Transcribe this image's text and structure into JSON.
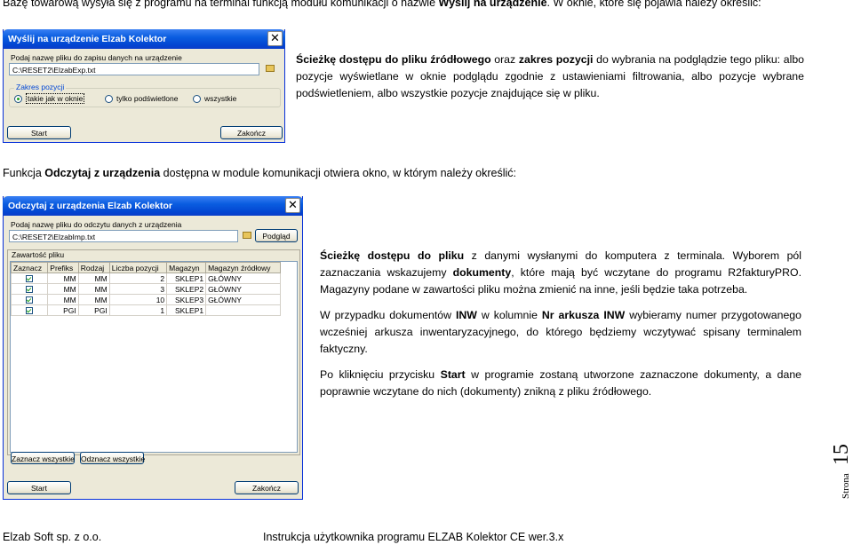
{
  "intro1": {
    "pre": "Bazę towarową wysyła się z programu na terminal funkcją modułu komunikacji o nazwie ",
    "bold": "Wyślij na urządzenie",
    "post": ". W oknie, które się pojawia należy określić:"
  },
  "win1": {
    "title": "Wyślij na urządzenie Elzab Kolektor",
    "close": "✕",
    "file_label": "Podaj nazwę pliku do zapisu danych na urządzenie",
    "file_value": "C:\\RESET2\\ElzabExp.txt",
    "group_title": "Zakres pozycji",
    "radio1": "takie jak w oknie",
    "radio2": "tylko podświetlone",
    "radio3": "wszystkie",
    "start": "Start",
    "close_btn": "Zakończ"
  },
  "desc1": {
    "b1": "Ścieżkę dostępu do pliku źródłowego",
    "t1": " oraz ",
    "b2": "zakres pozycji",
    "t2": " do wybrania na podglądzie tego pliku: albo pozycje wyświetlane w oknie podglądu zgodnie z ustawieniami filtrowania, albo pozycje wybrane podświetleniem, albo wszystkie pozycje znajdujące się w pliku."
  },
  "intro2": {
    "pre": "Funkcja ",
    "bold": "Odczytaj z urządzenia",
    "post": " dostępna w module komunikacji otwiera okno, w którym należy określić:"
  },
  "win2": {
    "title": "Odczytaj z urządzenia Elzab Kolektor",
    "close": "✕",
    "file_label": "Podaj nazwę pliku do odczytu danych z urządzenia",
    "file_value": "C:\\RESET2\\ElzabImp.txt",
    "preview_btn": "Podgląd",
    "tab": "Zawartość pliku",
    "columns": [
      "Zaznacz",
      "Prefiks",
      "Rodzaj",
      "Liczba pozycji",
      "Magazyn",
      "Magazyn źródłowy"
    ],
    "rows": [
      [
        "MM",
        "MM",
        "2",
        "SKLEP1",
        "GŁÓWNY"
      ],
      [
        "MM",
        "MM",
        "3",
        "SKLEP2",
        "GŁÓWNY"
      ],
      [
        "MM",
        "MM",
        "10",
        "SKLEP3",
        "GŁÓWNY"
      ],
      [
        "PGI",
        "PGI",
        "1",
        "SKLEP1",
        ""
      ]
    ],
    "select_all": "Zaznacz wszystkie",
    "deselect_all": "Odznacz wszystkie",
    "start": "Start",
    "close_btn": "Zakończ"
  },
  "desc2": {
    "p1_b1": "Ścieżkę dostępu do pliku",
    "p1_t1": " z danymi wysłanymi do komputera z terminala. Wyborem pól zaznaczania wskazujemy ",
    "p1_b2": "dokumenty",
    "p1_t2": ", które mają być wczytane do programu R2fakturyPRO. Magazyny podane w zawartości pliku można zmienić na inne, jeśli będzie taka potrzeba.",
    "p2_t1": "W przypadku dokumentów ",
    "p2_b1": "INW",
    "p2_t2": " w kolumnie ",
    "p2_b2": "Nr arkusza INW",
    "p2_t3": " wybieramy numer przygotowanego wcześniej arkusza inwentaryzacyjnego, do którego będziemy wczytywać spisany terminalem faktyczny.",
    "p3_t1": "Po kliknięciu przycisku ",
    "p3_b1": "Start",
    "p3_t2": " w programie zostaną utworzone zaznaczone dokumenty, a dane poprawnie wczytane do nich (dokumenty) znikną z pliku źródłowego."
  },
  "page": {
    "label": "Strona",
    "number": "15"
  },
  "footer": {
    "left": "Elzab Soft sp. z o.o.",
    "right": "Instrukcja użytkownika programu ELZAB Kolektor CE wer.3.x"
  }
}
